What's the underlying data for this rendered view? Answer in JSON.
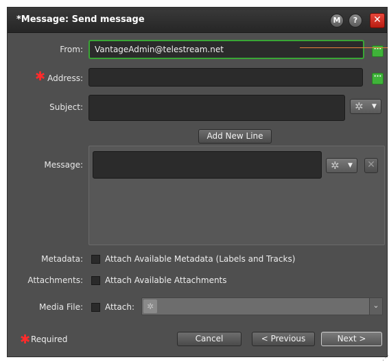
{
  "window": {
    "title": "*Message: Send message",
    "help_m": "M",
    "help_q": "?",
    "close": "✕"
  },
  "form": {
    "from": {
      "label": "From:",
      "value": "VantageAdmin@telestream.net"
    },
    "address": {
      "label": "Address:",
      "value": "",
      "required": true
    },
    "subject": {
      "label": "Subject:",
      "value": ""
    },
    "add_new_line": "Add New Line",
    "message": {
      "label": "Message:",
      "value": ""
    },
    "metadata": {
      "label": "Metadata:",
      "checkbox_label": "Attach Available Metadata (Labels and Tracks)",
      "checked": false
    },
    "attachments": {
      "label": "Attachments:",
      "checkbox_label": "Attach Available Attachments",
      "checked": false
    },
    "media_file": {
      "label": "Media File:",
      "checkbox_label": "Attach:",
      "checked": false,
      "selected": ""
    }
  },
  "footer": {
    "required_label": "Required",
    "cancel": "Cancel",
    "previous": "< Previous",
    "next": "Next >"
  },
  "colors": {
    "accent_green": "#3fb339",
    "required_red": "#ff2b2b",
    "pointer_orange": "#e8823a"
  },
  "icons": {
    "ellipsis": "···",
    "gear": "✲",
    "caret": "▼",
    "remove": "✕",
    "chevron": "⌄",
    "star": "✱"
  }
}
